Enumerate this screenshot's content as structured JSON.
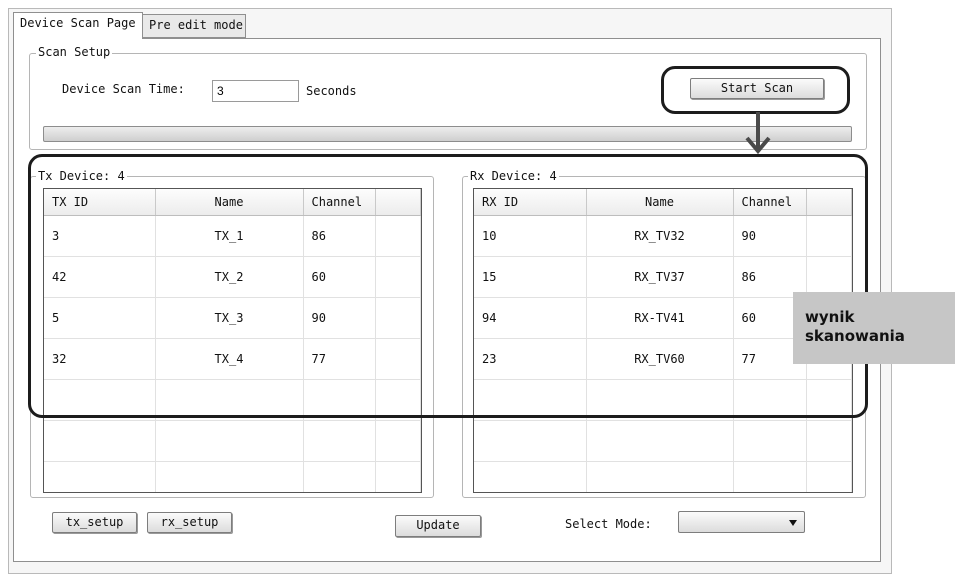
{
  "tabs": [
    {
      "label": "Device Scan Page",
      "active": true
    },
    {
      "label": "Pre edit mode",
      "active": false
    }
  ],
  "scan_setup": {
    "legend": "Scan Setup",
    "time_label": "Device Scan Time:",
    "time_value": "3",
    "unit_label": "Seconds",
    "start_button": "Start Scan"
  },
  "tx": {
    "legend": "Tx Device: 4",
    "headers": [
      "TX ID",
      "Name",
      "Channel"
    ],
    "rows": [
      [
        "3",
        "TX_1",
        "86"
      ],
      [
        "42",
        "TX_2",
        "60"
      ],
      [
        "5",
        "TX_3",
        "90"
      ],
      [
        "32",
        "TX_4",
        "77"
      ]
    ]
  },
  "rx": {
    "legend": "Rx Device: 4",
    "headers": [
      "RX ID",
      "Name",
      "Channel"
    ],
    "rows": [
      [
        "10",
        "RX_TV32",
        "90"
      ],
      [
        "15",
        "RX_TV37",
        "86"
      ],
      [
        "94",
        "RX-TV41",
        "60"
      ],
      [
        "23",
        "RX_TV60",
        "77"
      ]
    ]
  },
  "bottom": {
    "tx_setup": "tx_setup",
    "rx_setup": "rx_setup",
    "update": "Update",
    "select_mode_label": "Select Mode:",
    "select_mode_value": ""
  },
  "annotation": {
    "line1": "wynik",
    "line2": "skanowania"
  },
  "colors": {
    "callout": "#1c1c1c",
    "label_bg": "#c6c6c6"
  },
  "icons": {
    "dropdown": "triangle-down-icon",
    "arrow": "down-arrow-icon"
  }
}
